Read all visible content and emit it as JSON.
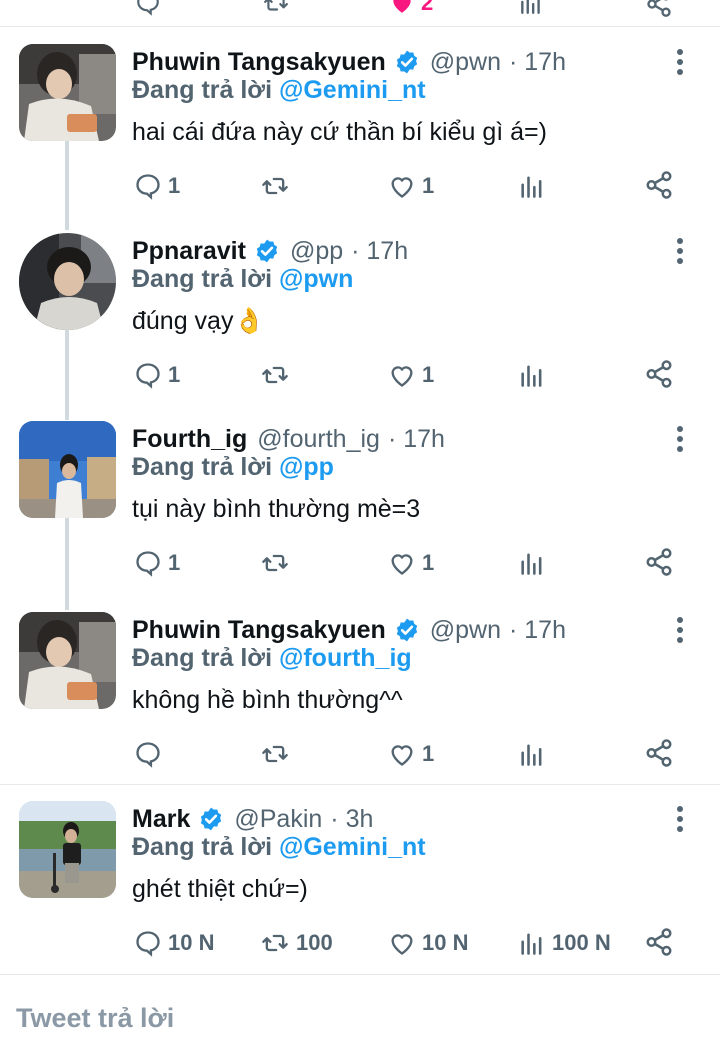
{
  "colors": {
    "accent": "#1d9bf0",
    "muted": "#536471",
    "like_active": "#f91880"
  },
  "top_partial": {
    "like_count": "2"
  },
  "tweets": [
    {
      "name": "Phuwin Tangsakyuen",
      "verified": true,
      "handle": "@pwn",
      "time": "· 17h",
      "replying_label": "Đang trả lời",
      "replying_to": "@Gemini_nt",
      "text": "hai cái đứa này cứ thần bí kiểu gì á=)",
      "reply_count": "1",
      "retweet_count": "",
      "like_count": "1",
      "view_count": ""
    },
    {
      "name": "Ppnaravit",
      "verified": true,
      "handle": "@pp",
      "time": "· 17h",
      "replying_label": "Đang trả lời",
      "replying_to": "@pwn",
      "text": "đúng vạy👌",
      "reply_count": "1",
      "retweet_count": "",
      "like_count": "1",
      "view_count": ""
    },
    {
      "name": "Fourth_ig",
      "verified": false,
      "handle": "@fourth_ig",
      "time": "· 17h",
      "replying_label": "Đang trả lời",
      "replying_to": "@pp",
      "text": "tụi này bình thường mè=3",
      "reply_count": "1",
      "retweet_count": "",
      "like_count": "1",
      "view_count": ""
    },
    {
      "name": "Phuwin Tangsakyuen",
      "verified": true,
      "handle": "@pwn",
      "time": "· 17h",
      "replying_label": "Đang trả lời",
      "replying_to": "@fourth_ig",
      "text": "không hề bình thường^^",
      "reply_count": "",
      "retweet_count": "",
      "like_count": "1",
      "view_count": ""
    },
    {
      "name": "Mark",
      "verified": true,
      "handle": "@Pakin",
      "time": "· 3h",
      "replying_label": "Đang trả lời",
      "replying_to": "@Gemini_nt",
      "text": "ghét thiệt chứ=)",
      "reply_count": "10 N",
      "retweet_count": "100",
      "like_count": "10 N",
      "view_count": "100 N"
    }
  ],
  "reply_placeholder": "Tweet trả lời"
}
